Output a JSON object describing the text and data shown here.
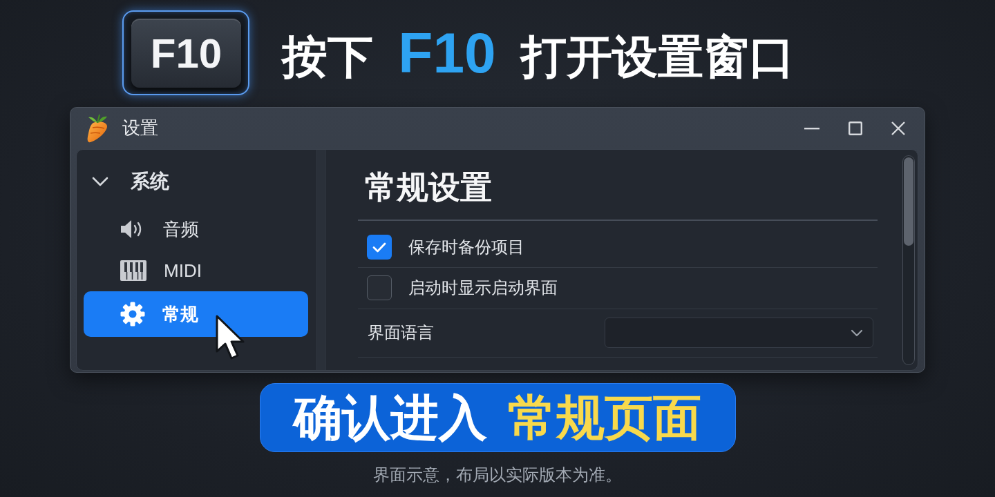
{
  "key_cap": {
    "label": "F10"
  },
  "headline": [
    {
      "text": "按下",
      "highlight": false
    },
    {
      "text": "F10",
      "highlight": true
    },
    {
      "text": "打开设置窗口",
      "highlight": false
    }
  ],
  "window": {
    "title": "设置"
  },
  "sidebar": {
    "tree": [
      {
        "label": "系统",
        "expanded": true,
        "selected": false,
        "children": [
          {
            "label": "音频",
            "selected": false
          },
          {
            "label": "MIDI",
            "selected": false
          },
          {
            "label": "常规",
            "selected": true
          }
        ]
      }
    ]
  },
  "content": {
    "title": "常规设置",
    "options": [
      {
        "kind": "checkbox",
        "label": "保存时备份项目",
        "checked": true
      },
      {
        "kind": "checkbox",
        "label": "启动时显示启动界面",
        "checked": false
      },
      {
        "kind": "select",
        "label": "界面语言"
      }
    ]
  },
  "banner": [
    {
      "text": "确认进入",
      "highlight": false
    },
    {
      "text": "常规页面",
      "highlight": true
    }
  ],
  "footnote": "界面示意，布局以实际版本为准。"
}
